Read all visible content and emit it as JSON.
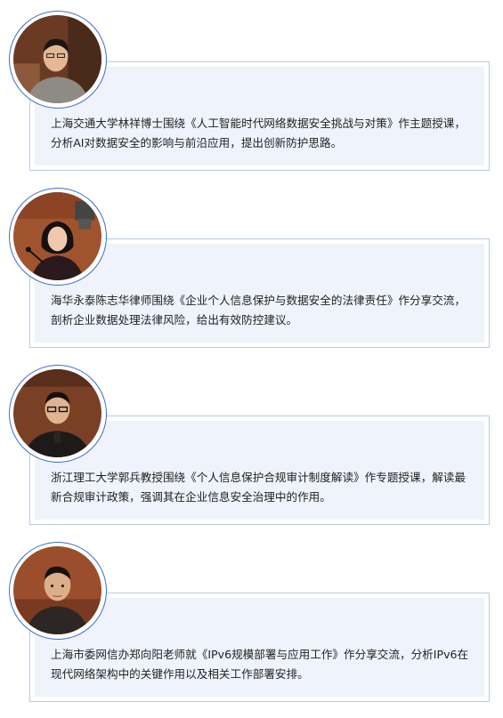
{
  "speakers": [
    {
      "text": "上海交通大学林祥博士围绕《人工智能时代网络数据安全挑战与对策》作主题授课，分析AI对数据安全的影响与前沿应用，提出创新防护思路。",
      "photo_icon": "speaker-photo-man-gray-sweater"
    },
    {
      "text": "海华永泰陈志华律师围绕《企业个人信息保护与数据安全的法律责任》作分享交流，剖析企业数据处理法律风险，给出有效防控建议。",
      "photo_icon": "speaker-photo-woman-microphone"
    },
    {
      "text": "浙江理工大学郭兵教授围绕《个人信息保护合规审计制度解读》作专题授课，解读最新合规审计政策，强调其在企业信息安全治理中的作用。",
      "photo_icon": "speaker-photo-man-glasses"
    },
    {
      "text": "上海市委网信办郑向阳老师就《IPv6规模部署与应用工作》作分享交流，分析IPv6在现代网络架构中的关键作用以及相关工作部署安排。",
      "photo_icon": "speaker-photo-man-dark-sweater"
    }
  ],
  "colors": {
    "ring": "#3a6fc9",
    "panel_border": "#b9cbe6",
    "panel_fill": "#eff3fb",
    "text": "#222222"
  }
}
